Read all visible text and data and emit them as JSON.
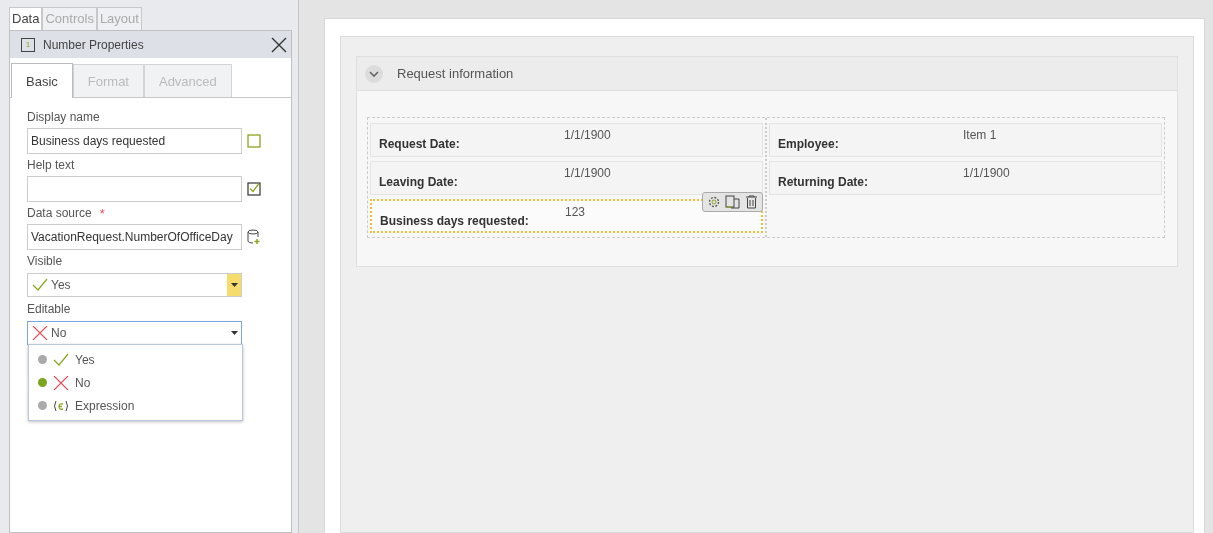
{
  "top_tabs": [
    {
      "label": "Data",
      "selected": true
    },
    {
      "label": "Controls",
      "selected": false
    },
    {
      "label": "Layout",
      "selected": false
    }
  ],
  "properties_panel": {
    "title": "Number Properties",
    "icon_text": "1",
    "tabs": [
      {
        "label": "Basic",
        "selected": true
      },
      {
        "label": "Format",
        "selected": false
      },
      {
        "label": "Advanced",
        "selected": false
      }
    ],
    "display_name": {
      "label": "Display name",
      "value": "Business days requested",
      "checked": false
    },
    "help_text": {
      "label": "Help text",
      "checked": true
    },
    "data_source": {
      "label": "Data source",
      "required_mark": "*",
      "value": "VacationRequest.NumberOfOfficeDay"
    },
    "visible": {
      "label": "Visible",
      "value": "Yes",
      "kind": "yes"
    },
    "editable": {
      "label": "Editable",
      "value": "No",
      "kind": "no",
      "expanded": true,
      "options": [
        {
          "label": "Yes",
          "kind": "yes",
          "selected": false
        },
        {
          "label": "No",
          "kind": "no",
          "selected": true
        },
        {
          "label": "Expression",
          "kind": "expression",
          "selected": false
        }
      ]
    }
  },
  "section": {
    "title": "Request information",
    "columns": [
      [
        {
          "label": "Request Date:",
          "value": "1/1/1900",
          "selected": false
        },
        {
          "label": "Leaving Date:",
          "value": "1/1/1900",
          "selected": false
        },
        {
          "label": "Business days requested:",
          "value": "123",
          "selected": true
        }
      ],
      [
        {
          "label": "Employee:",
          "value": "Item 1",
          "selected": false
        },
        {
          "label": "Returning Date:",
          "value": "1/1/1900",
          "selected": false
        }
      ]
    ]
  }
}
